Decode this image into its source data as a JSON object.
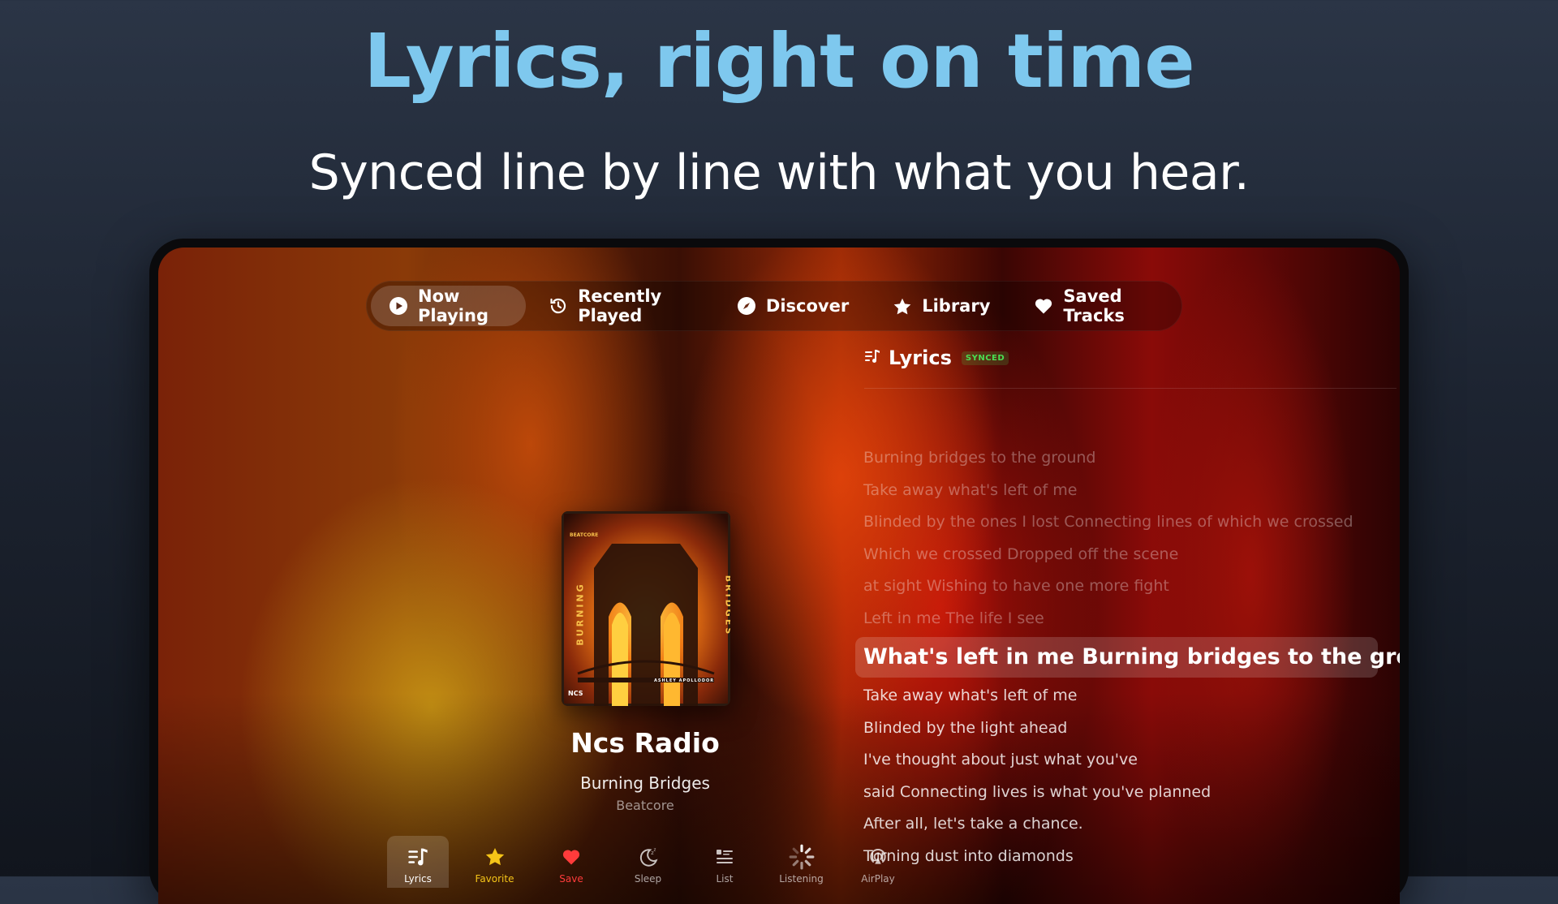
{
  "hero": {
    "headline": "Lyrics, right on time",
    "subheadline": "Synced line by line with what you hear."
  },
  "nav": {
    "items": [
      {
        "label": "Now Playing",
        "icon": "play-circle-icon",
        "active": true
      },
      {
        "label": "Recently Played",
        "icon": "history-icon"
      },
      {
        "label": "Discover",
        "icon": "compass-icon"
      },
      {
        "label": "Library",
        "icon": "star-icon"
      },
      {
        "label": "Saved Tracks",
        "icon": "heart-icon"
      }
    ]
  },
  "lyrics": {
    "title": "Lyrics",
    "badge": "SYNCED",
    "past_lines": [
      "Burning bridges to the ground",
      "Take away what's left of me",
      "Blinded by the ones I lost Connecting lines of which we crossed",
      "Which we crossed Dropped off the scene",
      "at sight Wishing to have one more fight",
      "Left in me The life I see"
    ],
    "current_line": "What's left in me Burning bridges to the ground",
    "upcoming_lines": [
      "Take away what's left of me",
      "Blinded by the light ahead",
      "I've thought about just what you've",
      "said Connecting lives is what you've planned",
      "After all, let's take a chance.",
      "Turning dust into diamonds"
    ]
  },
  "album_art": {
    "label": "BEATCORE",
    "title_left": "BURNING",
    "title_right": "BRIDGES",
    "artist": "ASHLEY APOLLODOR",
    "logo": "NCS"
  },
  "now_playing": {
    "station": "Ncs Radio",
    "track": "Burning Bridges",
    "artist": "Beatcore"
  },
  "bottom_bar": {
    "items": [
      {
        "label": "Lyrics",
        "icon": "lyrics-icon",
        "active": true
      },
      {
        "label": "Favorite",
        "icon": "favorite-star-icon",
        "color": "#f5c518"
      },
      {
        "label": "Save",
        "icon": "save-heart-icon",
        "color": "#ff3b3b"
      },
      {
        "label": "Sleep",
        "icon": "sleep-moon-icon"
      },
      {
        "label": "List",
        "icon": "list-icon"
      },
      {
        "label": "Listening",
        "icon": "listening-spinner-icon"
      },
      {
        "label": "AirPlay",
        "icon": "airplay-icon"
      }
    ]
  },
  "colors": {
    "headline": "#7ec8ee",
    "synced_badge": "#4ade52",
    "favorite": "#f5c518",
    "save": "#ff3b3b"
  }
}
